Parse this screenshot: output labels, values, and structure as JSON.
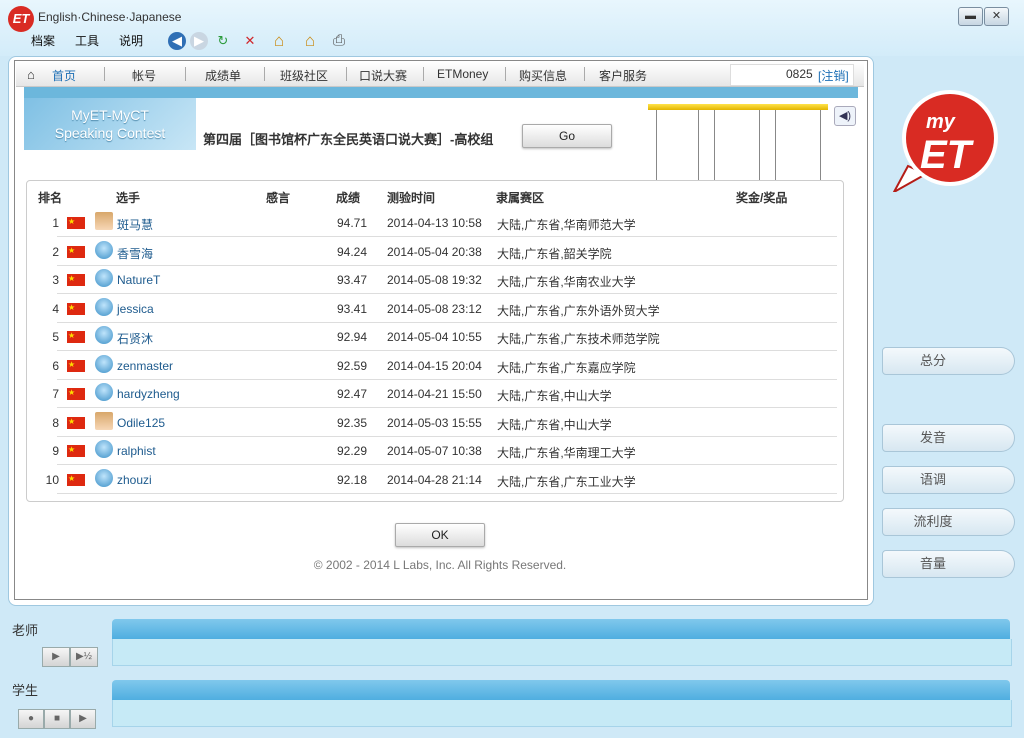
{
  "window": {
    "title": "English·Chinese·Japanese",
    "logo": "ET",
    "min": "▬",
    "close": "✕"
  },
  "menu": [
    "档案",
    "工具",
    "说明"
  ],
  "toolbar": {
    "back": "◀",
    "forward": "▶",
    "refresh": "↻",
    "stop": "✕",
    "home": "⌂",
    "home2": "⌂",
    "print": "⎙"
  },
  "nav": {
    "items": [
      "首页",
      "帐号",
      "成绩单",
      "班级社区",
      "口说大赛",
      "ETMoney",
      "购买信息",
      "客户服务"
    ],
    "user_id": "0825",
    "logout": "[注销]"
  },
  "contest": {
    "logo_line1": "MyET-MyCT",
    "logo_line2": "Speaking Contest",
    "title": "第四届［图书馆杯广东全民英语口说大赛］-高校组",
    "go": "Go"
  },
  "table": {
    "headers": {
      "rank": "排名",
      "player": "选手",
      "comment": "感言",
      "score": "成绩",
      "time": "测验时间",
      "region": "隶属赛区",
      "prize": "奖金/奖品"
    },
    "rows": [
      {
        "rank": "1",
        "name": "斑马慧",
        "score": "94.71",
        "time": "2014-04-13 10:58",
        "region": "大陆,广东省,华南师范大学",
        "avatar": "photo"
      },
      {
        "rank": "2",
        "name": "香雪海",
        "score": "94.24",
        "time": "2014-05-04 20:38",
        "region": "大陆,广东省,韶关学院",
        "avatar": "default"
      },
      {
        "rank": "3",
        "name": "NatureT",
        "score": "93.47",
        "time": "2014-05-08 19:32",
        "region": "大陆,广东省,华南农业大学",
        "avatar": "default"
      },
      {
        "rank": "4",
        "name": "jessica",
        "score": "93.41",
        "time": "2014-05-08 23:12",
        "region": "大陆,广东省,广东外语外贸大学",
        "avatar": "default"
      },
      {
        "rank": "5",
        "name": "石贤沐",
        "score": "92.94",
        "time": "2014-05-04 10:55",
        "region": "大陆,广东省,广东技术师范学院",
        "avatar": "default"
      },
      {
        "rank": "6",
        "name": "zenmaster",
        "score": "92.59",
        "time": "2014-04-15 20:04",
        "region": "大陆,广东省,广东嘉应学院",
        "avatar": "default"
      },
      {
        "rank": "7",
        "name": "hardyzheng",
        "score": "92.47",
        "time": "2014-04-21 15:50",
        "region": "大陆,广东省,中山大学",
        "avatar": "default"
      },
      {
        "rank": "8",
        "name": "Odile125",
        "score": "92.35",
        "time": "2014-05-03 15:55",
        "region": "大陆,广东省,中山大学",
        "avatar": "photo"
      },
      {
        "rank": "9",
        "name": "ralphist",
        "score": "92.29",
        "time": "2014-05-07 10:38",
        "region": "大陆,广东省,华南理工大学",
        "avatar": "default"
      },
      {
        "rank": "10",
        "name": "zhouzi",
        "score": "92.18",
        "time": "2014-04-28 21:14",
        "region": "大陆,广东省,广东工业大学",
        "avatar": "default"
      }
    ]
  },
  "ok": "OK",
  "copyright": "© 2002 - 2014 L Labs, Inc. All Rights Reserved.",
  "brand": {
    "line1": "my",
    "line2": "ET"
  },
  "side": {
    "total": "总分",
    "pronunciation": "发音",
    "intonation": "语调",
    "fluency": "流利度",
    "volume": "音量"
  },
  "bottom": {
    "teacher": "老师",
    "student": "学生",
    "play": "▶",
    "half": "▶½",
    "record": "●",
    "stop": "■"
  },
  "colors": {
    "accent": "#4faee0",
    "brand_red": "#d92b23",
    "flag_red": "#de2910",
    "flag_star": "#ffde00"
  }
}
